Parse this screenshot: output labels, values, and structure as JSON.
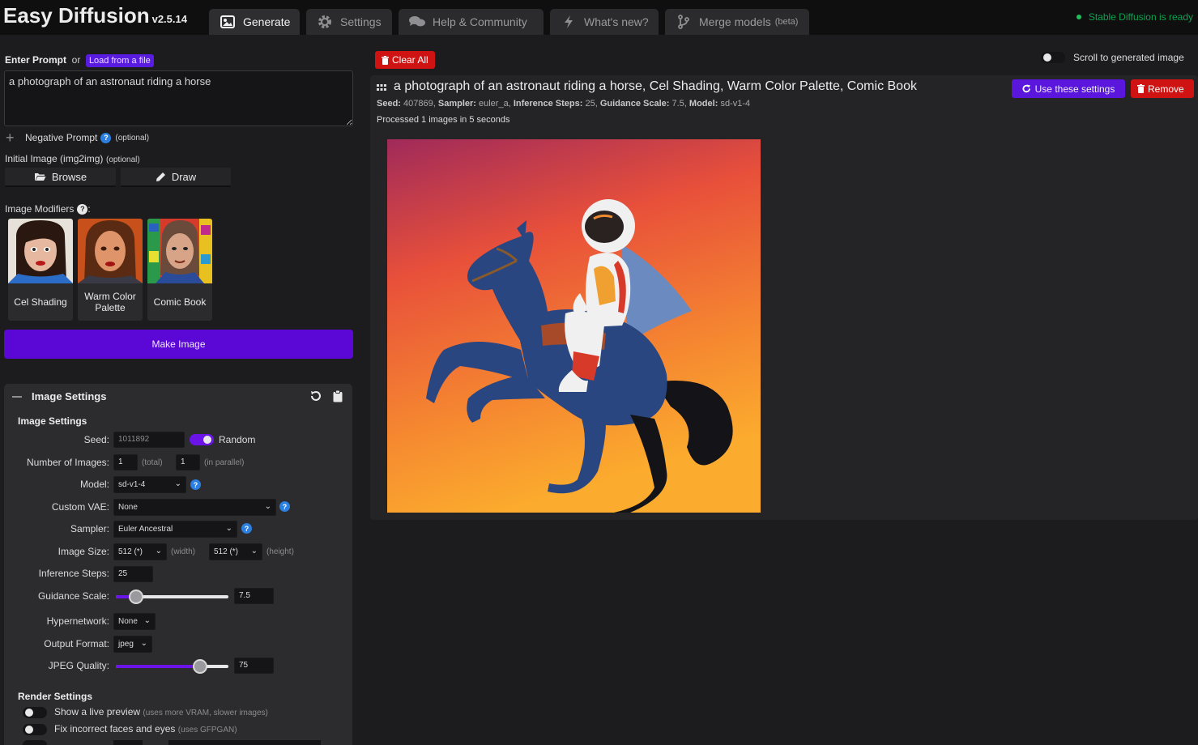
{
  "header": {
    "app_title": "Easy Diffusion",
    "version": "v2.5.14",
    "tabs": [
      {
        "label": "Generate",
        "icon": "image-icon"
      },
      {
        "label": "Settings",
        "icon": "gear-icon"
      },
      {
        "label": "Help & Community",
        "icon": "comments-icon"
      },
      {
        "label": "What's new?",
        "icon": "bolt-icon"
      },
      {
        "label": "Merge models",
        "icon": "merge-icon",
        "badge": "(beta)"
      }
    ],
    "status_text": "Stable Diffusion is ready"
  },
  "editor": {
    "prompt_label": "Enter Prompt",
    "prompt_or": "or",
    "load_file_label": "Load from a file",
    "prompt_value": "a photograph of an astronaut riding a horse",
    "negative_prompt_label": "Negative Prompt",
    "negative_optional": "(optional)",
    "initial_image_label": "Initial Image (img2img)",
    "initial_optional": "(optional)",
    "browse_label": "Browse",
    "draw_label": "Draw",
    "modifiers_label": "Image Modifiers",
    "modifiers_colon": ":",
    "modifiers": [
      {
        "label": "Cel Shading"
      },
      {
        "label": "Warm Color Palette"
      },
      {
        "label": "Comic Book"
      }
    ],
    "make_image_label": "Make Image"
  },
  "image_settings": {
    "panel_title": "Image Settings",
    "section_title": "Image Settings",
    "seed_label": "Seed:",
    "seed_value": "1011892",
    "random_label": "Random",
    "random_on": true,
    "num_images_label": "Number of Images:",
    "num_total": "1",
    "num_total_hint": "(total)",
    "num_parallel": "1",
    "num_parallel_hint": "(in parallel)",
    "model_label": "Model:",
    "model_value": "sd-v1-4",
    "vae_label": "Custom VAE:",
    "vae_value": "None",
    "sampler_label": "Sampler:",
    "sampler_value": "Euler Ancestral",
    "size_label": "Image Size:",
    "width_value": "512 (*)",
    "width_hint": "(width)",
    "height_value": "512 (*)",
    "height_hint": "(height)",
    "steps_label": "Inference Steps:",
    "steps_value": "25",
    "guidance_label": "Guidance Scale:",
    "guidance_value": "7.5",
    "guidance_fraction": 0.18,
    "hypernetwork_label": "Hypernetwork:",
    "hypernetwork_value": "None",
    "format_label": "Output Format:",
    "format_value": "jpeg",
    "jpeg_quality_label": "JPEG Quality:",
    "jpeg_quality_value": "75",
    "jpeg_quality_fraction": 0.75
  },
  "render_settings": {
    "section_title": "Render Settings",
    "live_preview_label": "Show a live preview",
    "live_preview_hint": "(uses more VRAM, slower images)",
    "fix_faces_label": "Fix incorrect faces and eyes",
    "fix_faces_hint": "(uses GFPGAN)"
  },
  "results": {
    "clear_all_label": "Clear All",
    "scroll_label": "Scroll to generated image",
    "task_title": "a photograph of an astronaut riding a horse, Cel Shading, Warm Color Palette, Comic Book",
    "meta": {
      "seed_key": "Seed:",
      "seed": "407869,",
      "sampler_key": "Sampler:",
      "sampler": "euler_a,",
      "steps_key": "Inference Steps:",
      "steps": "25,",
      "guidance_key": "Guidance Scale:",
      "guidance": "7.5,",
      "model_key": "Model:",
      "model": "sd-v1-4"
    },
    "processed_text": "Processed 1 images in 5 seconds",
    "use_settings_label": "Use these settings",
    "remove_label": "Remove"
  },
  "colors": {
    "accent_purple": "#5b08d6",
    "danger_red": "#cf1212",
    "status_green": "#1fbf5a"
  }
}
